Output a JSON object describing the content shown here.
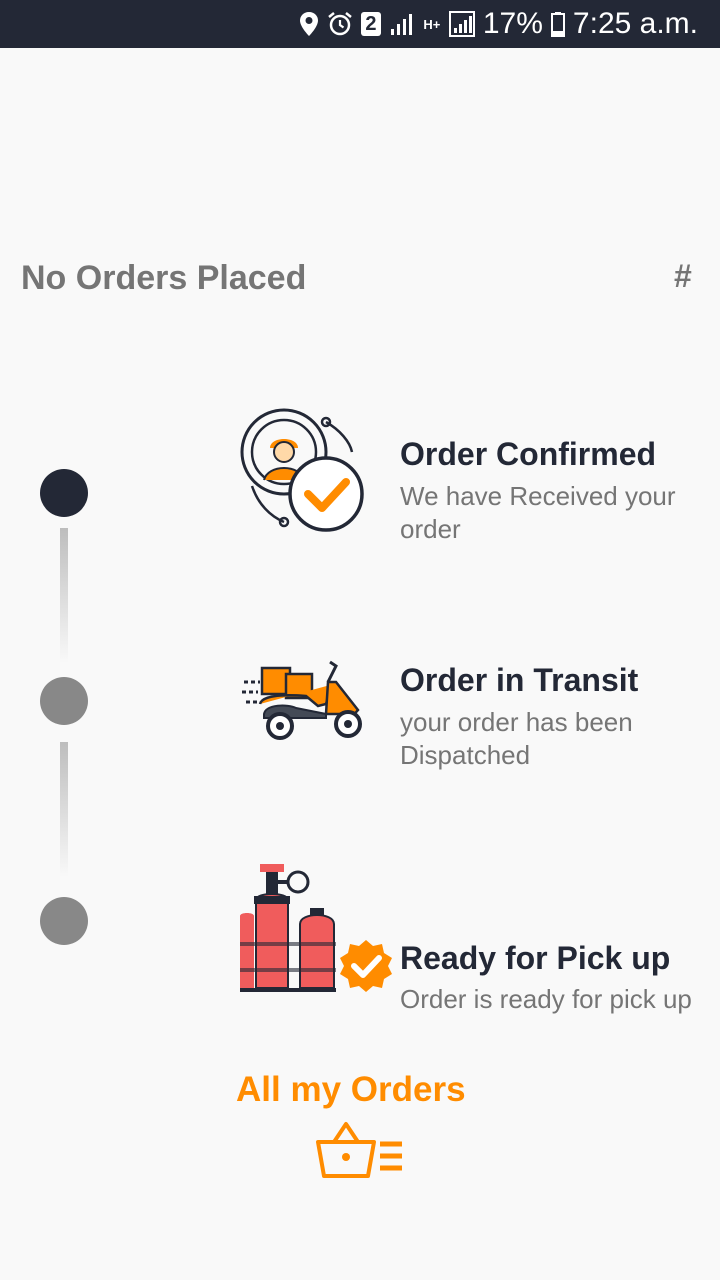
{
  "status_bar": {
    "sim_slot": "2",
    "network_type": "H+",
    "battery": "17%",
    "time": "7:25 a.m."
  },
  "header": {
    "title": "No Orders Placed",
    "order_number": "#"
  },
  "steps": [
    {
      "title": "Order Confirmed",
      "description": "We have Received your order",
      "icon": "delivery-person-check-icon",
      "state": "active"
    },
    {
      "title": "Order in Transit",
      "description": "your order has been Dispatched",
      "icon": "delivery-scooter-icon",
      "state": "inactive"
    },
    {
      "title": "Ready for Pick up",
      "description": "Order is ready for pick up",
      "icon": "gas-cylinder-check-icon",
      "state": "inactive"
    }
  ],
  "footer": {
    "all_orders_label": "All my Orders",
    "icon": "basket-list-icon"
  },
  "colors": {
    "status_bar": "#232836",
    "active_dot": "#232836",
    "inactive_dot": "#888888",
    "accent": "#ff8c00",
    "cylinder": "#f05c5c",
    "muted_text": "#757575"
  }
}
